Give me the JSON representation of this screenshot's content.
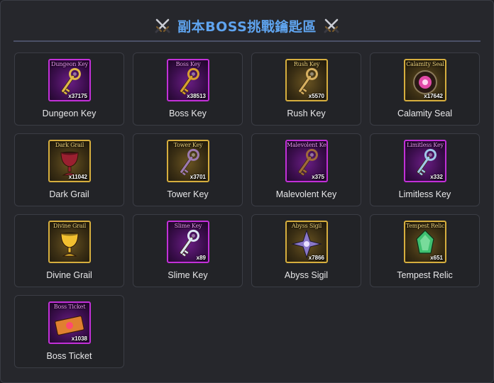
{
  "header": {
    "title": "副本BOSS挑戰鑰匙區"
  },
  "items": [
    {
      "name": "Dungeon Key",
      "label": "Dungeon Key",
      "count": "x37175",
      "frame": "purple",
      "icon": "dungeon-key-icon",
      "color": "#e0b84a"
    },
    {
      "name": "Boss Key",
      "label": "Boss Key",
      "count": "x38513",
      "frame": "purple",
      "icon": "boss-key-icon",
      "color": "#d8a030"
    },
    {
      "name": "Rush Key",
      "label": "Rush Key",
      "count": "x5570",
      "frame": "gold",
      "icon": "rush-key-icon",
      "color": "#d6b060"
    },
    {
      "name": "Calamity Seal",
      "label": "Calamity Seal",
      "count": "x17642",
      "frame": "gold",
      "icon": "calamity-seal-icon",
      "color": "#e24aa8"
    },
    {
      "name": "Dark Grail",
      "label": "Dark Grail",
      "count": "x11042",
      "frame": "gold",
      "icon": "dark-grail-icon",
      "color": "#9a2030"
    },
    {
      "name": "Tower Key",
      "label": "Tower Key",
      "count": "x3701",
      "frame": "gold",
      "icon": "tower-key-icon",
      "color": "#9c7ab0"
    },
    {
      "name": "Malevolent Key",
      "label": "Malevolent Key",
      "count": "x375",
      "frame": "purple",
      "icon": "malevolent-key-icon",
      "color": "#a06a3a"
    },
    {
      "name": "Limitless Key",
      "label": "Limitless Key",
      "count": "x332",
      "frame": "purple",
      "icon": "limitless-key-icon",
      "color": "#9fc8e8"
    },
    {
      "name": "Divine Grail",
      "label": "Divine Grail",
      "count": "",
      "frame": "gold",
      "icon": "divine-grail-icon",
      "color": "#f2c030"
    },
    {
      "name": "Slime Key",
      "label": "Slime Key",
      "count": "x89",
      "frame": "purple",
      "icon": "slime-key-icon",
      "color": "#dde6f2"
    },
    {
      "name": "Abyss Sigil",
      "label": "Abyss Sigil",
      "count": "x7866",
      "frame": "gold",
      "icon": "abyss-sigil-icon",
      "color": "#8a78c8"
    },
    {
      "name": "Tempest Relic",
      "label": "Tempest Relic",
      "count": "x651",
      "frame": "gold",
      "icon": "tempest-relic-icon",
      "color": "#3fc070"
    },
    {
      "name": "Boss Ticket",
      "label": "Boss Ticket",
      "count": "x1038",
      "frame": "purple",
      "icon": "boss-ticket-icon",
      "color": "#e08030"
    }
  ]
}
